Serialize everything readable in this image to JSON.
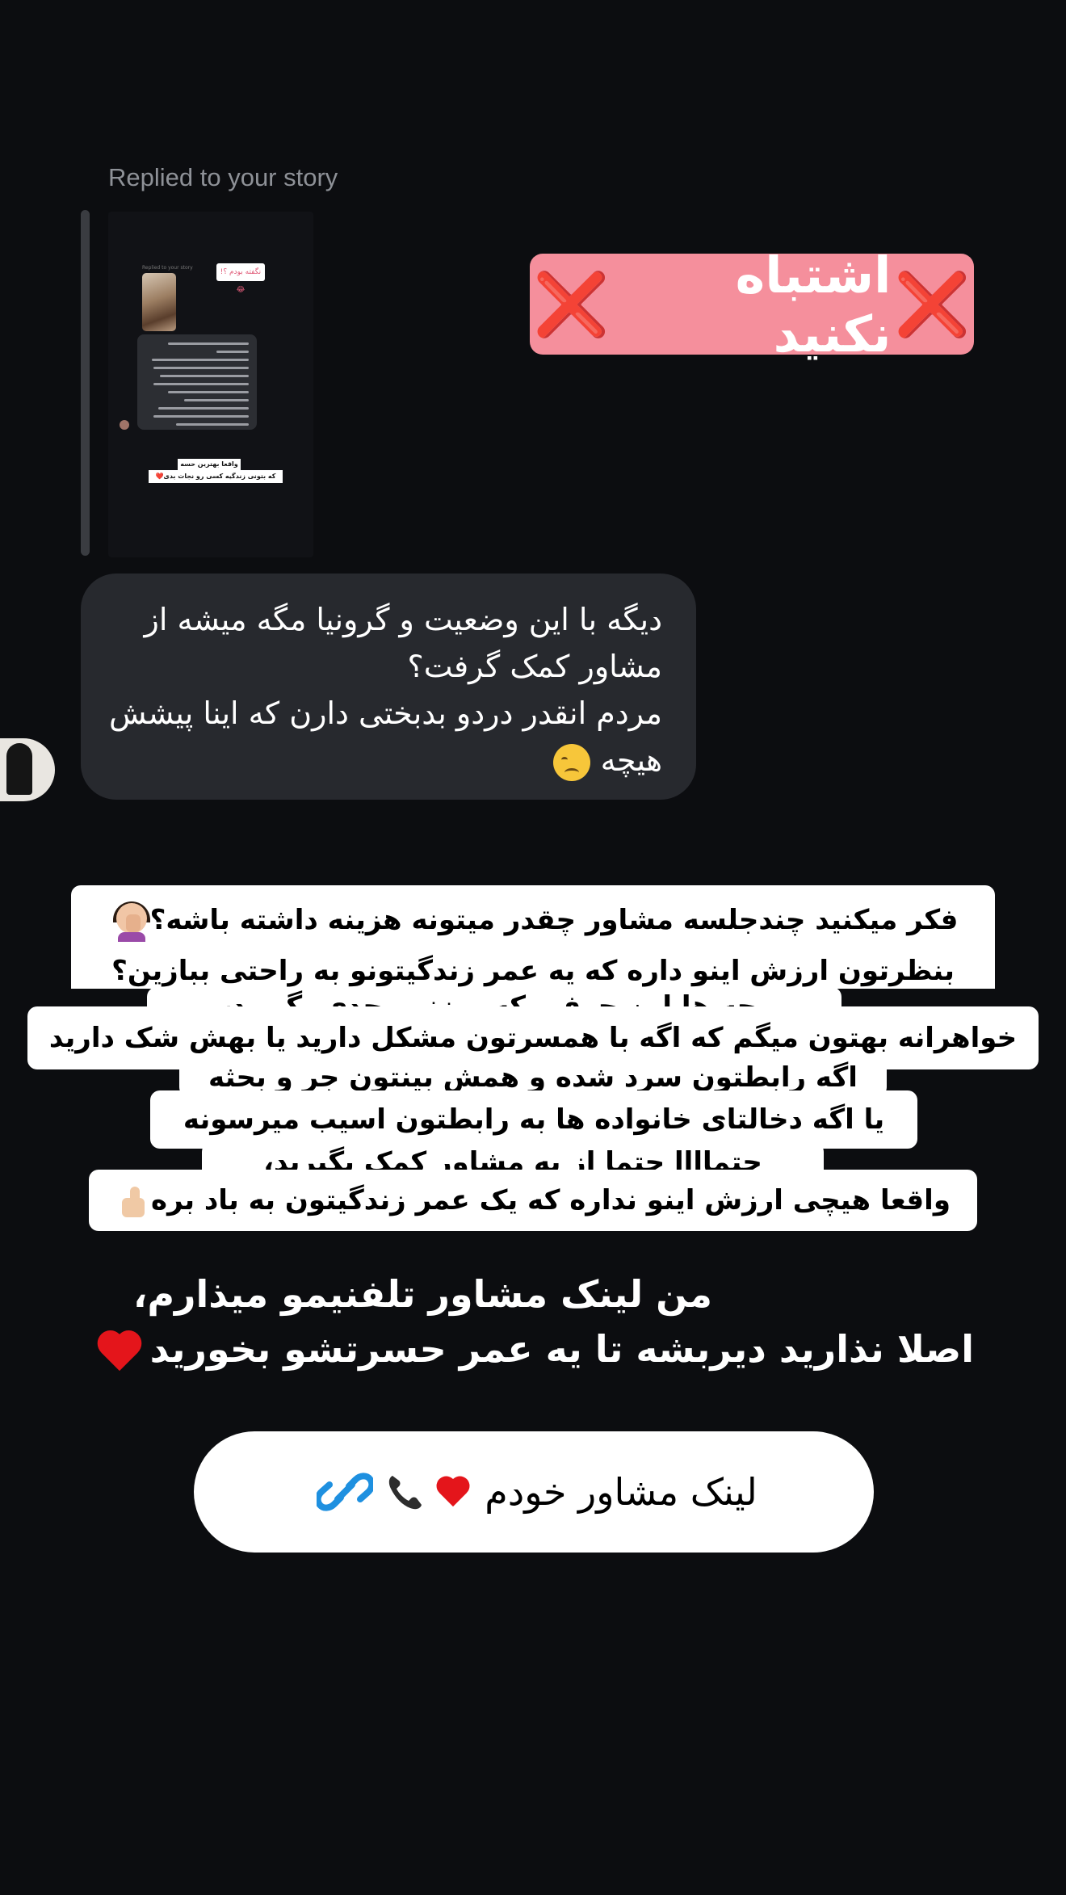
{
  "header": {
    "replied_label": "Replied to your story"
  },
  "story_thumbnail": {
    "small_label": "Replied to your story",
    "sticker_text": "نگفته بودم ؟!😂",
    "caption_line1": "واقعا بهترین حسه",
    "caption_line2": "که بتونی زندگیه کسی رو نجات بدی❤️"
  },
  "title_sticker": {
    "text": "اشتباه نکنید",
    "mark": "❌"
  },
  "message": {
    "paragraph1": "دیگه با این وضعیت و گرونیا مگه میشه از مشاور کمک گرفت؟",
    "paragraph2": "مردم انقدر دردو بدبختی دارن که اینا پیشش هیچه"
  },
  "caption_lines": [
    "فکر میکنید چندجلسه مشاور چقدر میتونه هزینه داشته باشه؟",
    "بنظرتون ارزش اینو داره که یه عمر زندگیتونو به راحتی ببازین؟",
    "بچه ها این حرفی که میزنمو جدی بگیرید،",
    "خواهرانه بهتون میگم که اگه با همسرتون مشکل دارید یا بهش شک دارید",
    "اگه رابطتون سرد شده و همش بینتون جر و بحثه",
    "یا اگه دخالتای خانواده ها به رابطتون اسیب میرسونه",
    "حتماااا حتما از یه مشاور کمک بگیرید،",
    "واقعا هیچی ارزش اینو نداره که یک عمر زندگیتون به باد بره"
  ],
  "statement": {
    "line1": "من لینک مشاور تلفنیمو میذارم،",
    "line2": "اصلا نذارید دیربشه تا یه عمر حسرتشو بخورید"
  },
  "link_sticker": {
    "label": "لینک مشاور خودم",
    "link_color": "#1e90e0"
  },
  "colors": {
    "background": "#0c0d10",
    "title_bg": "#f58f9c",
    "bubble_bg": "#27292e",
    "red": "#e4151b"
  }
}
